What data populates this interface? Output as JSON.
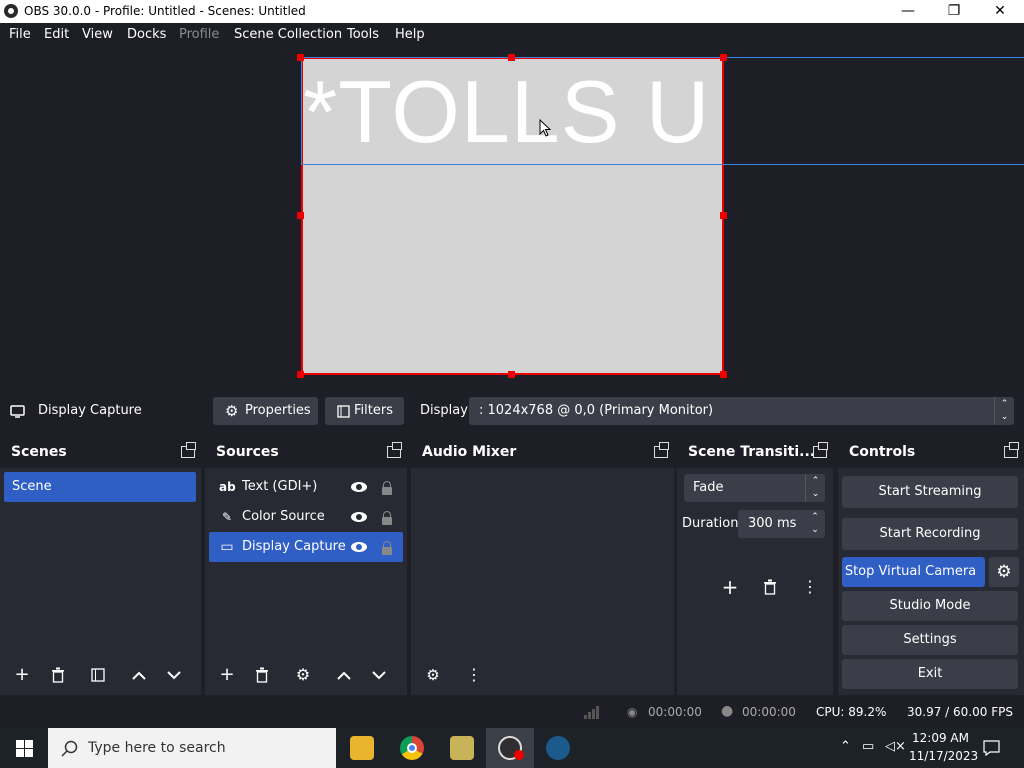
{
  "window": {
    "title": "OBS 30.0.0 - Profile: Untitled - Scenes: Untitled",
    "minimize": "—",
    "maximize": "❐",
    "close": "✕"
  },
  "menu": [
    "File",
    "Edit",
    "View",
    "Docks",
    "Profile",
    "Scene Collection",
    "Tools",
    "Help"
  ],
  "preview": {
    "text": "*TOLLS U"
  },
  "context_bar": {
    "source_name": "Display Capture",
    "properties_label": "Properties",
    "filters_label": "Filters",
    "display_label": "Display",
    "display_value": ": 1024x768 @ 0,0 (Primary Monitor)"
  },
  "scenes": {
    "title": "Scenes",
    "items": [
      "Scene"
    ]
  },
  "sources": {
    "title": "Sources",
    "items": [
      {
        "icon": "ab",
        "label": "Text (GDI+)"
      },
      {
        "icon": "✎",
        "label": "Color Source"
      },
      {
        "icon": "▭",
        "label": "Display Capture"
      }
    ]
  },
  "audio_mixer": {
    "title": "Audio Mixer"
  },
  "transitions": {
    "title": "Scene Transiti...",
    "selected": "Fade",
    "duration_label": "Duration",
    "duration_value": "300 ms"
  },
  "controls": {
    "title": "Controls",
    "start_streaming": "Start Streaming",
    "start_recording": "Start Recording",
    "stop_virtual_camera": "Stop Virtual Camera",
    "studio_mode": "Studio Mode",
    "settings": "Settings",
    "exit": "Exit"
  },
  "status": {
    "stream_time": "00:00:00",
    "record_time": "00:00:00",
    "cpu": "CPU: 89.2%",
    "fps": "30.97 / 60.00 FPS"
  },
  "taskbar": {
    "search_placeholder": "Type here to search",
    "time": "12:09 AM",
    "date": "11/17/2023"
  },
  "colors": {
    "accent": "#2f5ec4",
    "selection_border": "#ee0000",
    "guide_line": "#3a84e6"
  }
}
